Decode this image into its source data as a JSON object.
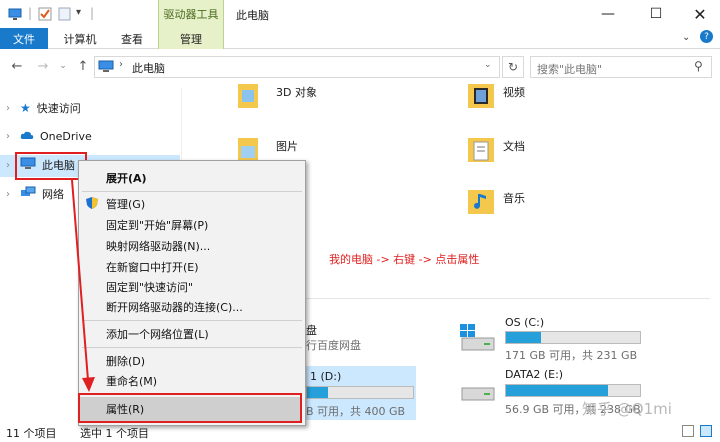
{
  "window": {
    "title": "此电脑",
    "context_tab_header": "驱动器工具"
  },
  "ribbon": {
    "tabs": [
      "文件",
      "计算机",
      "查看",
      "管理"
    ]
  },
  "address": {
    "path": "此电脑",
    "search_placeholder": "搜索\"此电脑\""
  },
  "sidebar": {
    "items": [
      "快速访问",
      "OneDrive",
      "此电脑",
      "网络"
    ]
  },
  "folders": [
    "3D 对象",
    "视频",
    "图片",
    "文档",
    "音乐"
  ],
  "annotation": "我的电脑 -> 右键 -> 点击属性",
  "drives": [
    {
      "name": "OS (C:)",
      "info": "171 GB 可用，共 231 GB",
      "used_fraction": 0.26
    },
    {
      "name": "DATA2 (E:)",
      "info": "56.9 GB 可用，共 238 GB",
      "used_fraction": 0.76
    },
    {
      "name_partial": "盘",
      "info_partial": "行百度网盘"
    },
    {
      "name_partial": "1 (D:)",
      "info_partial": "B 可用，共 400 GB",
      "used_fraction": 0.2
    }
  ],
  "status": {
    "count": "11 个项目",
    "selected": "选中 1 个项目"
  },
  "context_menu": {
    "items": [
      "展开(A)",
      "管理(G)",
      "固定到\"开始\"屏幕(P)",
      "映射网络驱动器(N)...",
      "在新窗口中打开(E)",
      "固定到\"快速访问\"",
      "断开网络驱动器的连接(C)...",
      "添加一个网络位置(L)",
      "删除(D)",
      "重命名(M)",
      "属性(R)"
    ]
  },
  "watermark": "知乎 @Q1mi",
  "colors": {
    "accent": "#1979ca",
    "selection": "#cce8ff",
    "annotation_red": "#e02020",
    "drive_fill": "#26a0da",
    "context_tab": "#e6f0c9"
  }
}
